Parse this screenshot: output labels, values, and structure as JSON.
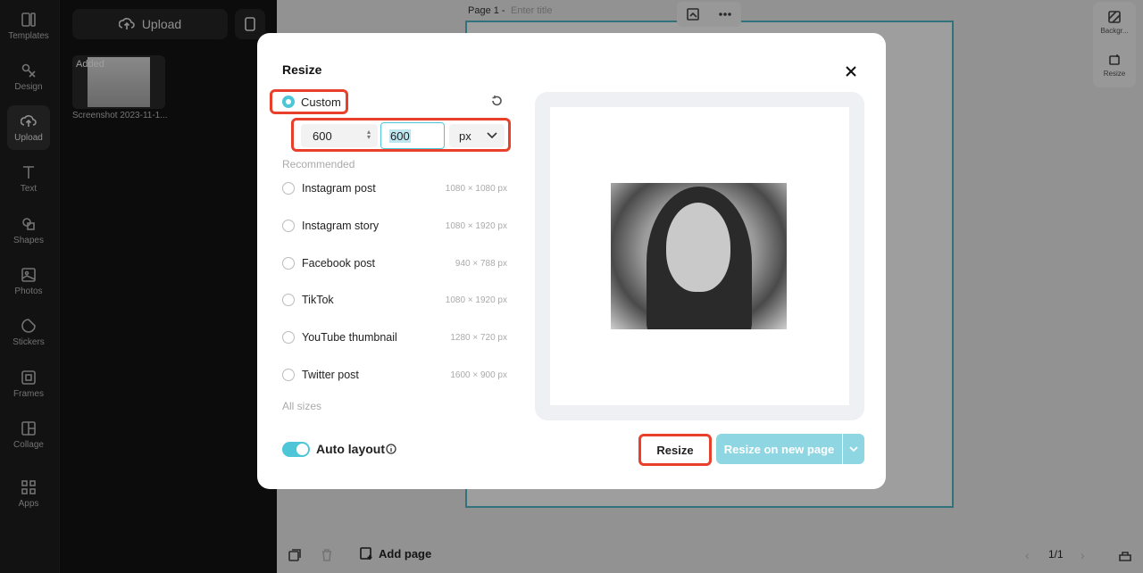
{
  "nav": {
    "items": [
      {
        "label": "Templates",
        "icon": "templates-icon"
      },
      {
        "label": "Design",
        "icon": "design-icon"
      },
      {
        "label": "Upload",
        "icon": "upload-icon"
      },
      {
        "label": "Text",
        "icon": "text-icon"
      },
      {
        "label": "Shapes",
        "icon": "shapes-icon"
      },
      {
        "label": "Photos",
        "icon": "photos-icon"
      },
      {
        "label": "Stickers",
        "icon": "stickers-icon"
      },
      {
        "label": "Frames",
        "icon": "frames-icon"
      },
      {
        "label": "Collage",
        "icon": "collage-icon"
      },
      {
        "label": "Apps",
        "icon": "apps-icon"
      }
    ],
    "active": "Upload"
  },
  "panel": {
    "upload_label": "Upload",
    "thumb_tag": "Added",
    "thumb_name": "Screenshot 2023-11-1..."
  },
  "canvas": {
    "page_label": "Page 1 -",
    "title_placeholder": "Enter title",
    "right_tools": [
      "Backgr...",
      "Resize"
    ],
    "add_page": "Add page",
    "pager": "1/1"
  },
  "modal": {
    "title": "Resize",
    "custom_label": "Custom",
    "width": "600",
    "height": "600",
    "unit": "px",
    "recommended_label": "Recommended",
    "presets": [
      {
        "name": "Instagram post",
        "dims": "1080 × 1080 px"
      },
      {
        "name": "Instagram story",
        "dims": "1080 × 1920 px"
      },
      {
        "name": "Facebook post",
        "dims": "940 × 788 px"
      },
      {
        "name": "TikTok",
        "dims": "1080 × 1920 px"
      },
      {
        "name": "YouTube thumbnail",
        "dims": "1280 × 720 px"
      },
      {
        "name": "Twitter post",
        "dims": "1600 × 900 px"
      }
    ],
    "all_sizes": "All sizes",
    "auto_layout": "Auto layout",
    "resize_button": "Resize",
    "resize_new_button": "Resize on new page"
  },
  "colors": {
    "accent": "#4ec6d8",
    "highlight": "#e8402a",
    "accent_light": "#8fd6e3"
  }
}
